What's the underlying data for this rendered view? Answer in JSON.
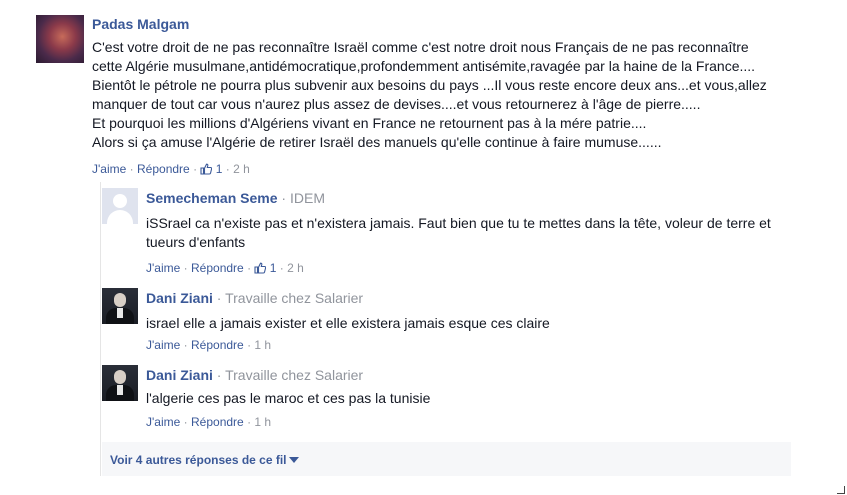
{
  "top_comment": {
    "author": "Padas Malgam",
    "body_lines": [
      "C'est votre droit de ne pas reconnaître Israël comme c'est notre droit nous Français de ne pas reconnaître",
      "cette Algérie musulmane,antidémocratique,profondemment antisémite,ravagée par la haine de la France....",
      "Bientôt le pétrole ne pourra plus subvenir aux besoins du pays ...Il vous reste encore deux ans...et vous,allez",
      "manquer de tout car vous n'aurez plus assez de devises....et vous retournerez à l'âge de pierre.....",
      "Et pourquoi les millions d'Algériens vivant en France ne retournent pas à la mére patrie....",
      "Alors si ça amuse l'Algérie de retirer Israël des manuels qu'elle continue à faire mumuse......"
    ],
    "like_label": "J'aime",
    "reply_label": "Répondre",
    "like_count": "1",
    "time": "2 h",
    "sep": "·"
  },
  "replies": [
    {
      "author": "Semecheman Seme",
      "subtitle": "IDEM",
      "body_lines": [
        "iSSrael ca n'existe pas et n'existera jamais. Faut bien que tu te mettes dans la tête, voleur de terre et",
        "tueurs d'enfants"
      ],
      "like_label": "J'aime",
      "reply_label": "Répondre",
      "like_count": "1",
      "time": "2 h"
    },
    {
      "author": "Dani Ziani",
      "subtitle": "Travaille chez Salarier",
      "body_lines": [
        "israel elle a jamais exister et elle existera jamais esque ces claire"
      ],
      "like_label": "J'aime",
      "reply_label": "Répondre",
      "time": "1 h"
    },
    {
      "author": "Dani Ziani",
      "subtitle": "Travaille chez Salarier",
      "body_lines": [
        "l'algerie ces pas le maroc et ces pas la tunisie"
      ],
      "like_label": "J'aime",
      "reply_label": "Répondre",
      "time": "1 h"
    }
  ],
  "more_replies_label": "Voir 4 autres réponses de ce fil",
  "colors": {
    "link": "#3b5998",
    "meta": "#90949c",
    "panel_bg": "#f6f7f9"
  },
  "icons": [
    "thumbs-up-icon",
    "chevron-down-icon",
    "resize-handle-icon"
  ]
}
